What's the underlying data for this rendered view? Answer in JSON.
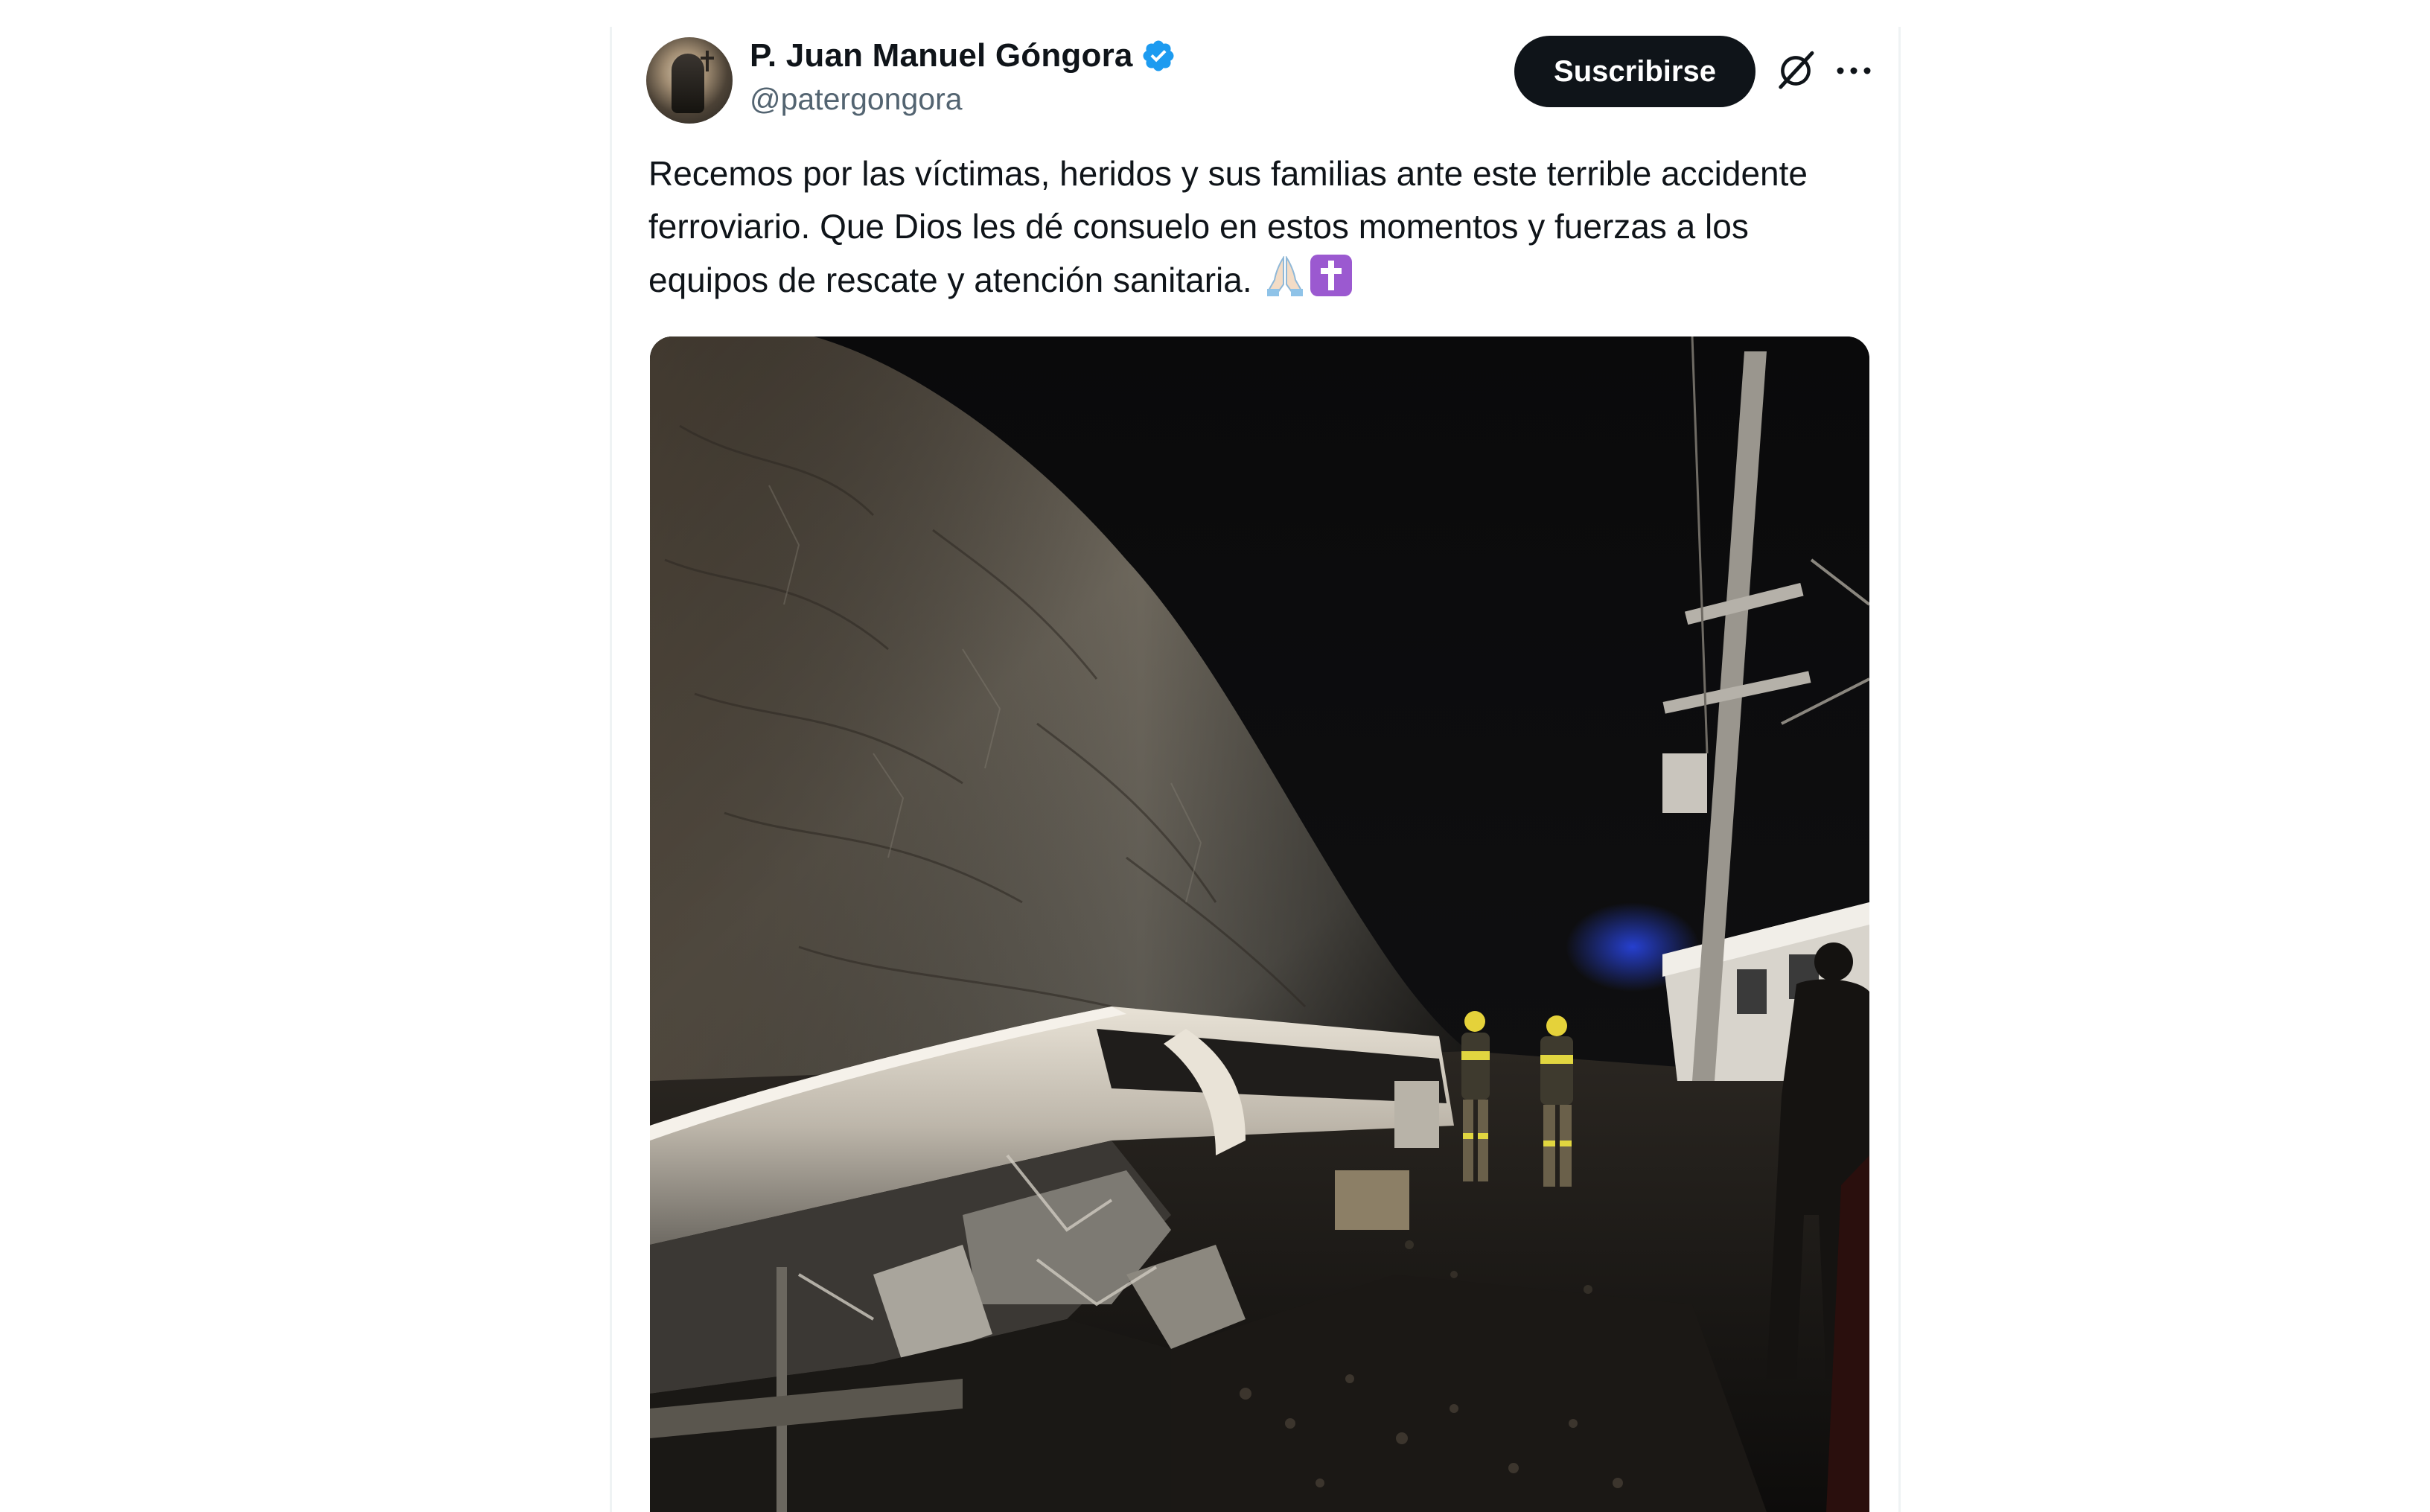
{
  "tweet": {
    "author": {
      "display_name": "P. Juan Manuel Góngora",
      "handle": "@patergongora",
      "verified": true,
      "verified_badge_color": "#1d9bf0"
    },
    "actions": {
      "subscribe_label": "Suscribirse",
      "grok_icon": "grok-icon",
      "more_icon": "more-icon"
    },
    "text": "Recemos por las víctimas, heridos y sus familias ante este terrible accidente ferroviario. Que Dios les dé consuelo en estos momentos y fuerzas a los equipos de rescate y atención sanitaria.",
    "emojis": [
      "🙏🏻",
      "✝️"
    ],
    "media": {
      "type": "photo"
    }
  },
  "colors": {
    "text_primary": "#0f1419",
    "text_secondary": "#536471",
    "button_bg": "#0f1419",
    "button_text": "#ffffff",
    "border": "#eff3f4",
    "emoji_cross_bg": "#9b59d0"
  }
}
